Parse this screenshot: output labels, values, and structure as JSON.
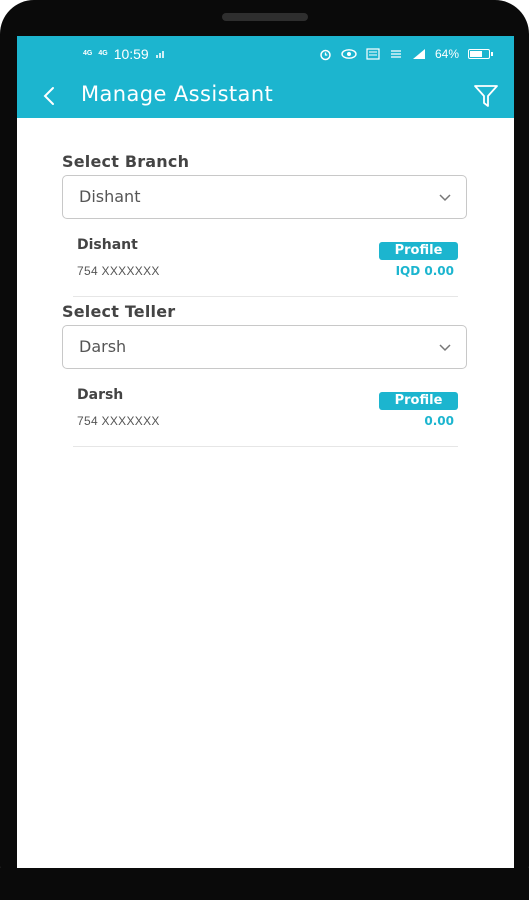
{
  "status_bar": {
    "network_left": "4G",
    "time": "10:59",
    "battery_percent": "64%"
  },
  "app_bar": {
    "title": "Manage Assistant",
    "back_icon": "chevron-left-icon",
    "filter_icon": "filter-icon"
  },
  "branch": {
    "label": "Select Branch",
    "selected": "Dishant",
    "card": {
      "name": "Dishant",
      "account": "754 XXXXXXX",
      "profile_label": "Profile",
      "balance": "IQD 0.00"
    }
  },
  "teller": {
    "label": "Select Teller",
    "selected": "Darsh",
    "card": {
      "name": "Darsh",
      "account": "754 XXXXXXX",
      "profile_label": "Profile",
      "balance": "0.00"
    }
  },
  "colors": {
    "accent": "#1cb5cf",
    "frame": "#0a0a0a",
    "text": "#444444"
  }
}
